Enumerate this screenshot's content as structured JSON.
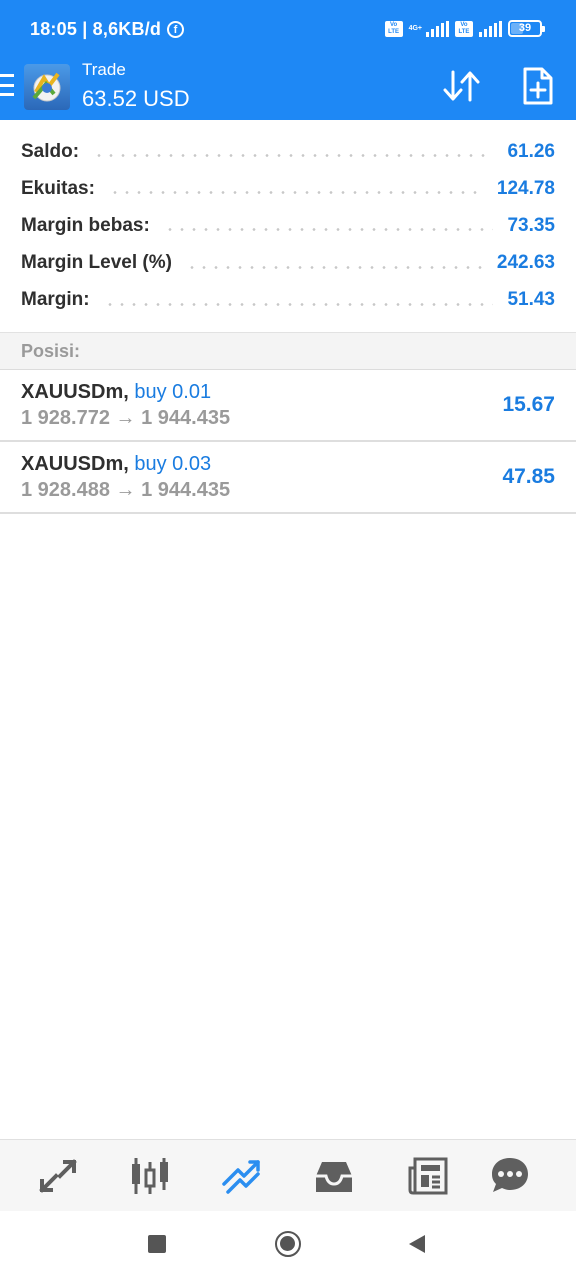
{
  "status_bar": {
    "time_speed": "18:05 | 8,6KB/d",
    "fb_icon": "f",
    "network_label": "4G+",
    "volte_label": "Vo LTE",
    "battery_level": "39"
  },
  "app_bar": {
    "title": "Trade",
    "balance": "63.52 USD",
    "menu_icon": "hamburger-icon",
    "sort_icon": "sort-arrows-icon",
    "new_order_icon": "new-document-icon"
  },
  "summary": [
    {
      "label": "Saldo:",
      "value": "61.26"
    },
    {
      "label": "Ekuitas:",
      "value": "124.78"
    },
    {
      "label": "Margin bebas:",
      "value": "73.35"
    },
    {
      "label": "Margin Level (%)",
      "value": "242.63"
    },
    {
      "label": "Margin:",
      "value": "51.43"
    }
  ],
  "positions_header": "Posisi:",
  "positions": [
    {
      "symbol": "XAUUSDm,",
      "side": "buy 0.01",
      "prices": "1 928.772 → 1 944.435",
      "profit": "15.67"
    },
    {
      "symbol": "XAUUSDm,",
      "side": "buy 0.03",
      "prices": "1 928.488 → 1 944.435",
      "profit": "47.85"
    }
  ],
  "bottom_nav": [
    "quotes-icon",
    "chart-icon",
    "trade-icon",
    "history-icon",
    "news-icon",
    "chat-icon"
  ],
  "colors": {
    "primary": "#1e88f5",
    "accent_text": "#1a7ce0",
    "active_nav": "#2b8ef0"
  }
}
